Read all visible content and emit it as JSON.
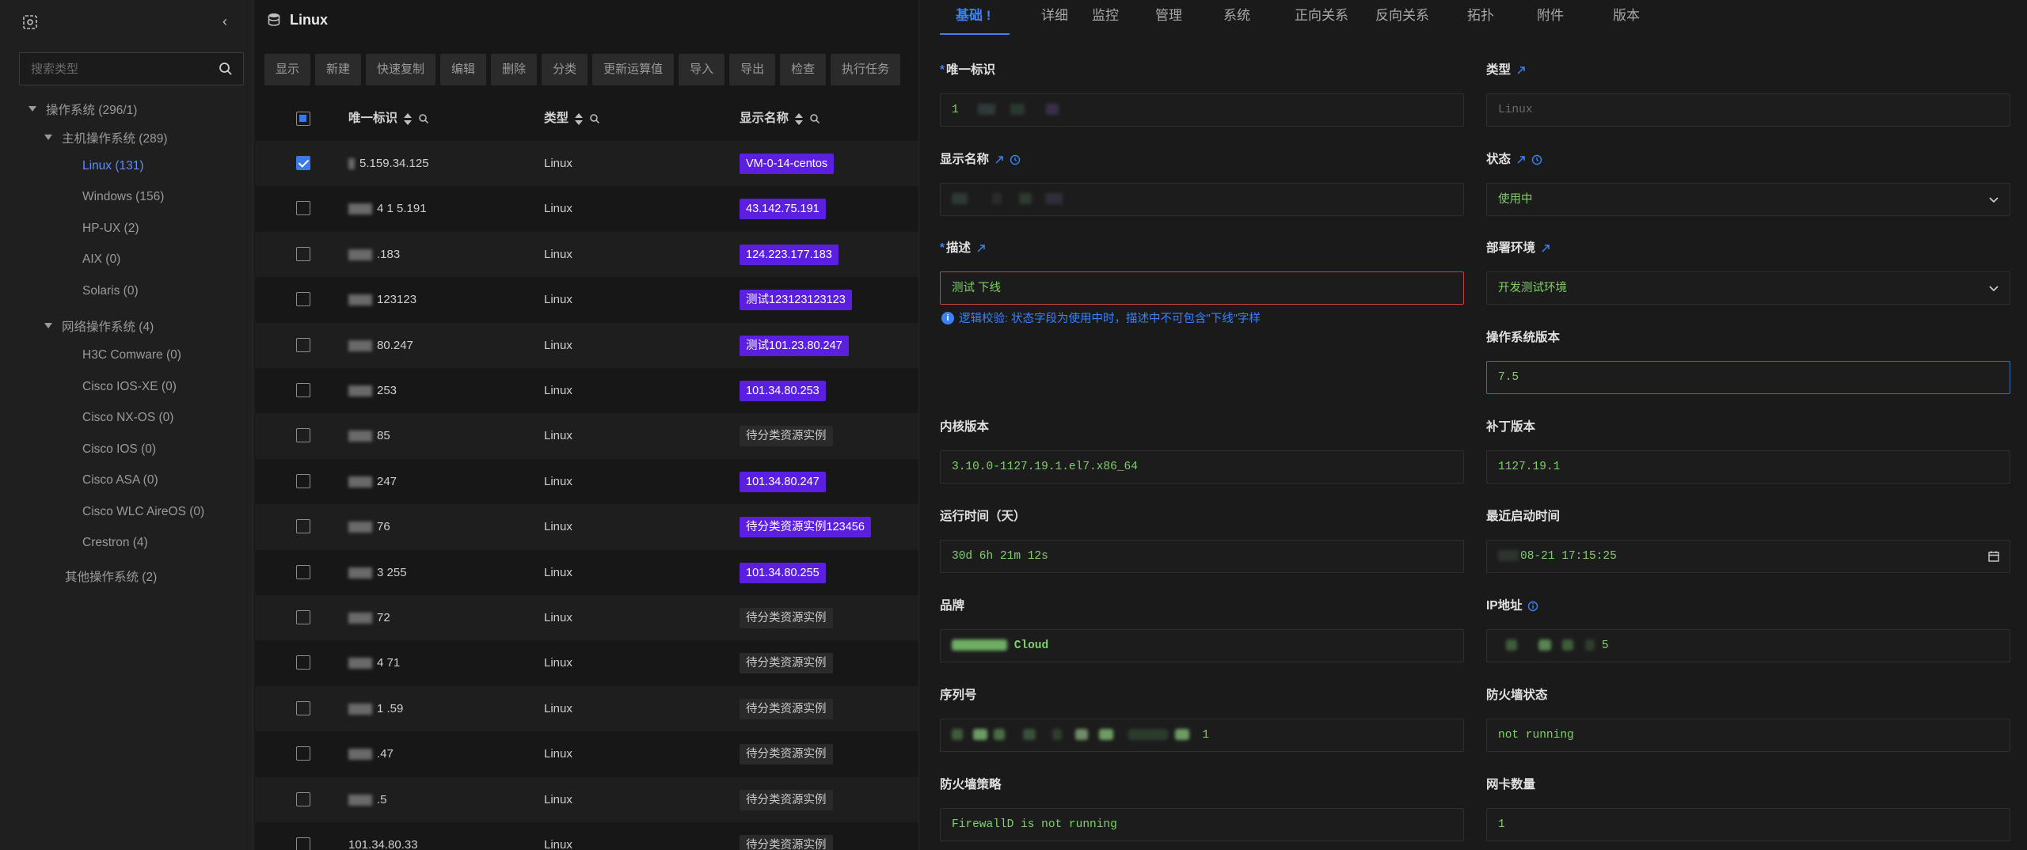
{
  "left": {
    "search_placeholder": "搜索类型",
    "tree": [
      {
        "label": "操作系统 (296/1)",
        "level": 0,
        "expanded": true,
        "selected": false
      },
      {
        "label": "主机操作系统 (289)",
        "level": 1,
        "expanded": true,
        "selected": false
      },
      {
        "label": "Linux (131)",
        "level": 2,
        "expanded": false,
        "selected": true
      },
      {
        "label": "Windows (156)",
        "level": 2,
        "expanded": false,
        "selected": false
      },
      {
        "label": "HP-UX (2)",
        "level": 2,
        "expanded": false,
        "selected": false
      },
      {
        "label": "AIX (0)",
        "level": 2,
        "expanded": false,
        "selected": false
      },
      {
        "label": "Solaris (0)",
        "level": 2,
        "expanded": false,
        "selected": false
      },
      {
        "label": "网络操作系统 (4)",
        "level": 1,
        "expanded": true,
        "selected": false
      },
      {
        "label": "H3C Comware (0)",
        "level": 2,
        "expanded": false,
        "selected": false
      },
      {
        "label": "Cisco IOS-XE (0)",
        "level": 2,
        "expanded": false,
        "selected": false
      },
      {
        "label": "Cisco NX-OS (0)",
        "level": 2,
        "expanded": false,
        "selected": false
      },
      {
        "label": "Cisco IOS (0)",
        "level": 2,
        "expanded": false,
        "selected": false
      },
      {
        "label": "Cisco ASA (0)",
        "level": 2,
        "expanded": false,
        "selected": false
      },
      {
        "label": "Cisco WLC AireOS (0)",
        "level": 2,
        "expanded": false,
        "selected": false
      },
      {
        "label": "Crestron (4)",
        "level": 2,
        "expanded": false,
        "selected": false
      },
      {
        "label": "其他操作系统 (2)",
        "level": 1,
        "expanded": false,
        "selected": false
      }
    ]
  },
  "mid": {
    "title": "Linux",
    "toolbar": [
      "显示",
      "新建",
      "快速复制",
      "编辑",
      "删除",
      "分类",
      "更新运算值",
      "导入",
      "导出",
      "检查",
      "执行任务"
    ],
    "columns": {
      "uid": "唯一标识",
      "type": "类型",
      "name": "显示名称"
    },
    "rows": [
      {
        "uid": "5.159.34.125",
        "type": "Linux",
        "name": "VM-0-14-centos",
        "tag": "purple",
        "checked": true
      },
      {
        "uid": "4 1 5.191",
        "type": "Linux",
        "name": "43.142.75.191",
        "tag": "purple",
        "checked": false
      },
      {
        "uid": ".183",
        "type": "Linux",
        "name": "124.223.177.183",
        "tag": "purple",
        "checked": false
      },
      {
        "uid": "123123",
        "type": "Linux",
        "name": "测试123123123123",
        "tag": "purple",
        "checked": false
      },
      {
        "uid": "80.247",
        "type": "Linux",
        "name": "测试101.23.80.247",
        "tag": "purple",
        "checked": false
      },
      {
        "uid": "253",
        "type": "Linux",
        "name": "101.34.80.253",
        "tag": "purple",
        "checked": false
      },
      {
        "uid": "85",
        "type": "Linux",
        "name": "待分类资源实例",
        "tag": "gray",
        "checked": false
      },
      {
        "uid": "247",
        "type": "Linux",
        "name": "101.34.80.247",
        "tag": "purple",
        "checked": false
      },
      {
        "uid": "76",
        "type": "Linux",
        "name": "待分类资源实例123456",
        "tag": "purple",
        "checked": false
      },
      {
        "uid": "3 255",
        "type": "Linux",
        "name": "101.34.80.255",
        "tag": "purple",
        "checked": false
      },
      {
        "uid": "72",
        "type": "Linux",
        "name": "待分类资源实例",
        "tag": "gray",
        "checked": false
      },
      {
        "uid": "4 71",
        "type": "Linux",
        "name": "待分类资源实例",
        "tag": "gray",
        "checked": false
      },
      {
        "uid": "1 .59",
        "type": "Linux",
        "name": "待分类资源实例",
        "tag": "gray",
        "checked": false
      },
      {
        "uid": ".47",
        "type": "Linux",
        "name": "待分类资源实例",
        "tag": "gray",
        "checked": false
      },
      {
        "uid": ".5",
        "type": "Linux",
        "name": "待分类资源实例",
        "tag": "gray",
        "checked": false
      },
      {
        "uid": "101.34.80.33",
        "type": "Linux",
        "name": "待分类资源实例",
        "tag": "gray",
        "checked": false
      }
    ]
  },
  "right": {
    "tabs": [
      "基础 !",
      "详细",
      "监控",
      "管理",
      "系统",
      "正向关系",
      "反向关系",
      "拓扑",
      "附件",
      "版本"
    ],
    "active_tab": 0,
    "fields": {
      "uid": {
        "label": "唯一标识",
        "value": "1"
      },
      "type": {
        "label": "类型",
        "value": "Linux"
      },
      "name": {
        "label": "显示名称",
        "value": ""
      },
      "status": {
        "label": "状态",
        "value": "使用中"
      },
      "desc": {
        "label": "描述",
        "value": "测试 下线"
      },
      "desc_hint": "逻辑校验: 状态字段为使用中时，描述中不可包含\"下线\"字样",
      "env": {
        "label": "部署环境",
        "value": "开发测试环境"
      },
      "os_version": {
        "label": "操作系统版本",
        "value": "7.5"
      },
      "kernel": {
        "label": "内核版本",
        "value": "3.10.0-1127.19.1.el7.x86_64"
      },
      "patch": {
        "label": "补丁版本",
        "value": "1127.19.1"
      },
      "uptime": {
        "label": "运行时间（天）",
        "value": "30d 6h 21m 12s"
      },
      "boot_time": {
        "label": "最近启动时间",
        "value": "08-21 17:15:25"
      },
      "brand": {
        "label": "品牌",
        "value": "Cloud"
      },
      "ip": {
        "label": "IP地址",
        "value": "5"
      },
      "serial": {
        "label": "序列号",
        "value": "1"
      },
      "fw_status": {
        "label": "防火墙状态",
        "value": "not running"
      },
      "fw_policy": {
        "label": "防火墙策略",
        "value": "FirewallD is not running"
      },
      "nic_count": {
        "label": "网卡数量",
        "value": "1"
      }
    }
  }
}
